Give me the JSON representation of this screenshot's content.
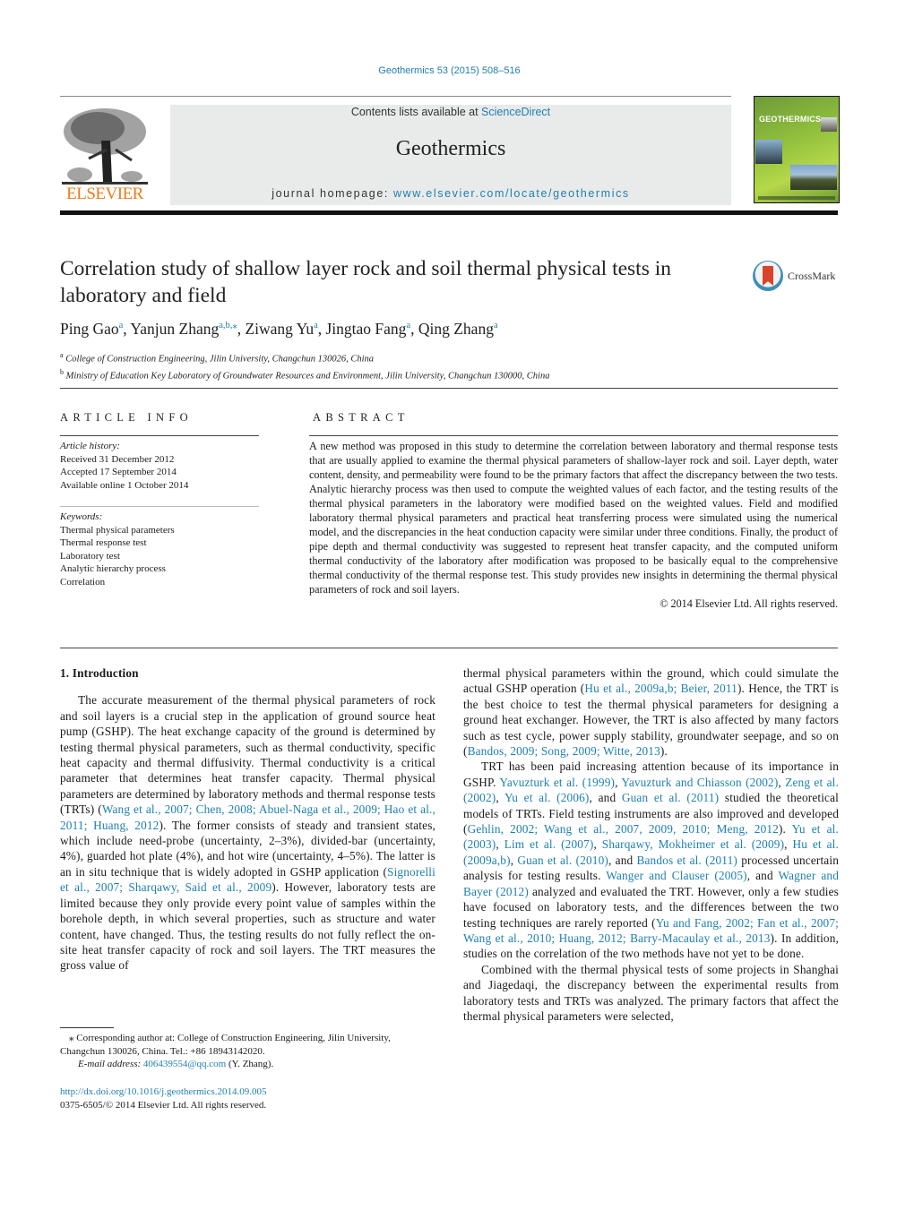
{
  "header": {
    "citation": "Geothermics 53 (2015) 508–516",
    "publisher_logo_text": "ELSEVIER",
    "contents_prefix": "Contents lists available at ",
    "contents_link": "ScienceDirect",
    "journal_name": "Geothermics",
    "homepage_prefix": "journal homepage: ",
    "homepage_link": "www.elsevier.com/locate/geothermics",
    "cover_title": "GEOTHERMICS",
    "crossmark_label": "CrossMark"
  },
  "article": {
    "title": "Correlation study of shallow layer rock and soil thermal physical tests in laboratory and field",
    "authors": [
      {
        "name": "Ping Gao",
        "sup": "a"
      },
      {
        "name": "Yanjun Zhang",
        "sup": "a,b,⁎"
      },
      {
        "name": "Ziwang Yu",
        "sup": "a"
      },
      {
        "name": "Jingtao Fang",
        "sup": "a"
      },
      {
        "name": "Qing Zhang",
        "sup": "a"
      }
    ],
    "affiliations": [
      {
        "key": "a",
        "text": "College of Construction Engineering, Jilin University, Changchun 130026, China"
      },
      {
        "key": "b",
        "text": "Ministry of Education Key Laboratory of Groundwater Resources and Environment, Jilin University, Changchun 130000, China"
      }
    ]
  },
  "article_info": {
    "heading": "ARTICLE INFO",
    "history_label": "Article history:",
    "history": [
      "Received 31 December 2012",
      "Accepted 17 September 2014",
      "Available online 1 October 2014"
    ],
    "keywords_label": "Keywords:",
    "keywords": [
      "Thermal physical parameters",
      "Thermal response test",
      "Laboratory test",
      "Analytic hierarchy process",
      "Correlation"
    ]
  },
  "abstract": {
    "heading": "ABSTRACT",
    "text": "A new method was proposed in this study to determine the correlation between laboratory and thermal response tests that are usually applied to examine the thermal physical parameters of shallow-layer rock and soil. Layer depth, water content, density, and permeability were found to be the primary factors that affect the discrepancy between the two tests. Analytic hierarchy process was then used to compute the weighted values of each factor, and the testing results of the thermal physical parameters in the laboratory were modified based on the weighted values. Field and modified laboratory thermal physical parameters and practical heat transferring process were simulated using the numerical model, and the discrepancies in the heat conduction capacity were similar under three conditions. Finally, the product of pipe depth and thermal conductivity was suggested to represent heat transfer capacity, and the computed uniform thermal conductivity of the laboratory after modification was proposed to be basically equal to the comprehensive thermal conductivity of the thermal response test. This study provides new insights in determining the thermal physical parameters of rock and soil layers.",
    "copyright": "© 2014 Elsevier Ltd. All rights reserved."
  },
  "body": {
    "section_heading": "1.  Introduction",
    "left_paragraphs": [
      [
        {
          "t": "The accurate measurement of the thermal physical parameters of rock and soil layers is a crucial step in the application of ground source heat pump (GSHP). The heat exchange capacity of the ground is determined by testing thermal physical parameters, such as thermal conductivity, specific heat capacity and thermal diffusivity. Thermal conductivity is a critical parameter that determines heat transfer capacity. Thermal physical parameters are determined by laboratory methods and thermal response tests (TRTs) ("
        },
        {
          "t": "Wang et al., 2007; Chen, 2008; Abuel-Naga et al., 2009; Hao et al., 2011; Huang, 2012",
          "link": true
        },
        {
          "t": "). The former consists of steady and transient states, which include need-probe (uncertainty, 2–3%), divided-bar (uncertainty, 4%), guarded hot plate (4%), and hot wire (uncertainty, 4–5%). The latter is an in situ technique that is widely adopted in GSHP application ("
        },
        {
          "t": "Signorelli et al., 2007; Sharqawy, Said et al., 2009",
          "link": true
        },
        {
          "t": "). However, laboratory tests are limited because they only provide every point value of samples within the borehole depth, in which several properties, such as structure and water content, have changed. Thus, the testing results do not fully reflect the on-site heat transfer capacity of rock and soil layers. The TRT measures the gross value of"
        }
      ]
    ],
    "right_paragraphs": [
      [
        {
          "t": "thermal physical parameters within the ground, which could simulate the actual GSHP operation ("
        },
        {
          "t": "Hu et al., 2009a,b; Beier, 2011",
          "link": true
        },
        {
          "t": "). Hence, the TRT is the best choice to test the thermal physical parameters for designing a ground heat exchanger. However, the TRT is also affected by many factors such as test cycle, power supply stability, groundwater seepage, and so on ("
        },
        {
          "t": "Bandos, 2009; Song, 2009; Witte, 2013",
          "link": true
        },
        {
          "t": ")."
        }
      ],
      [
        {
          "t": "TRT has been paid increasing attention because of its importance in GSHP. "
        },
        {
          "t": "Yavuzturk et al. (1999)",
          "link": true
        },
        {
          "t": ", "
        },
        {
          "t": "Yavuzturk and Chiasson (2002)",
          "link": true
        },
        {
          "t": ", "
        },
        {
          "t": "Zeng et al. (2002)",
          "link": true
        },
        {
          "t": ", "
        },
        {
          "t": "Yu et al. (2006)",
          "link": true
        },
        {
          "t": ", and "
        },
        {
          "t": "Guan et al. (2011)",
          "link": true
        },
        {
          "t": " studied the theoretical models of TRTs. Field testing instruments are also improved and developed ("
        },
        {
          "t": "Gehlin, 2002; Wang et al., 2007, 2009, 2010; Meng, 2012",
          "link": true
        },
        {
          "t": "). "
        },
        {
          "t": "Yu et al. (2003)",
          "link": true
        },
        {
          "t": ", "
        },
        {
          "t": "Lim et al. (2007)",
          "link": true
        },
        {
          "t": ", "
        },
        {
          "t": "Sharqawy, Mokheimer et al. (2009)",
          "link": true
        },
        {
          "t": ", "
        },
        {
          "t": "Hu et al. (2009a,b)",
          "link": true
        },
        {
          "t": ", "
        },
        {
          "t": "Guan et al. (2010)",
          "link": true
        },
        {
          "t": ", and "
        },
        {
          "t": "Bandos et al. (2011)",
          "link": true
        },
        {
          "t": " processed uncertain analysis for testing results. "
        },
        {
          "t": "Wanger and Clauser (2005)",
          "link": true
        },
        {
          "t": ", and "
        },
        {
          "t": "Wagner and Bayer (2012)",
          "link": true
        },
        {
          "t": " analyzed and evaluated the TRT. However, only a few studies have focused on laboratory tests, and the differences between the two testing techniques are rarely reported ("
        },
        {
          "t": "Yu and Fang, 2002; Fan et al., 2007; Wang et al., 2010; Huang, 2012; Barry-Macaulay et al., 2013",
          "link": true
        },
        {
          "t": "). In addition, studies on the correlation of the two methods have not yet to be done."
        }
      ],
      [
        {
          "t": "Combined with the thermal physical tests of some projects in Shanghai and Jiagedaqi, the discrepancy between the experimental results from laboratory tests and TRTs was analyzed. The primary factors that affect the thermal physical parameters were selected,"
        }
      ]
    ]
  },
  "footnotes": {
    "corresponding": "⁎ Corresponding author at: College of Construction Engineering, Jilin University, Changchun 130026, China. Tel.: +86 18943142020.",
    "email_label": "E-mail address: ",
    "email": "406439554@qq.com",
    "email_suffix": " (Y. Zhang).",
    "doi": "http://dx.doi.org/10.1016/j.geothermics.2014.09.005",
    "issn_copyright": "0375-6505/© 2014 Elsevier Ltd. All rights reserved."
  }
}
